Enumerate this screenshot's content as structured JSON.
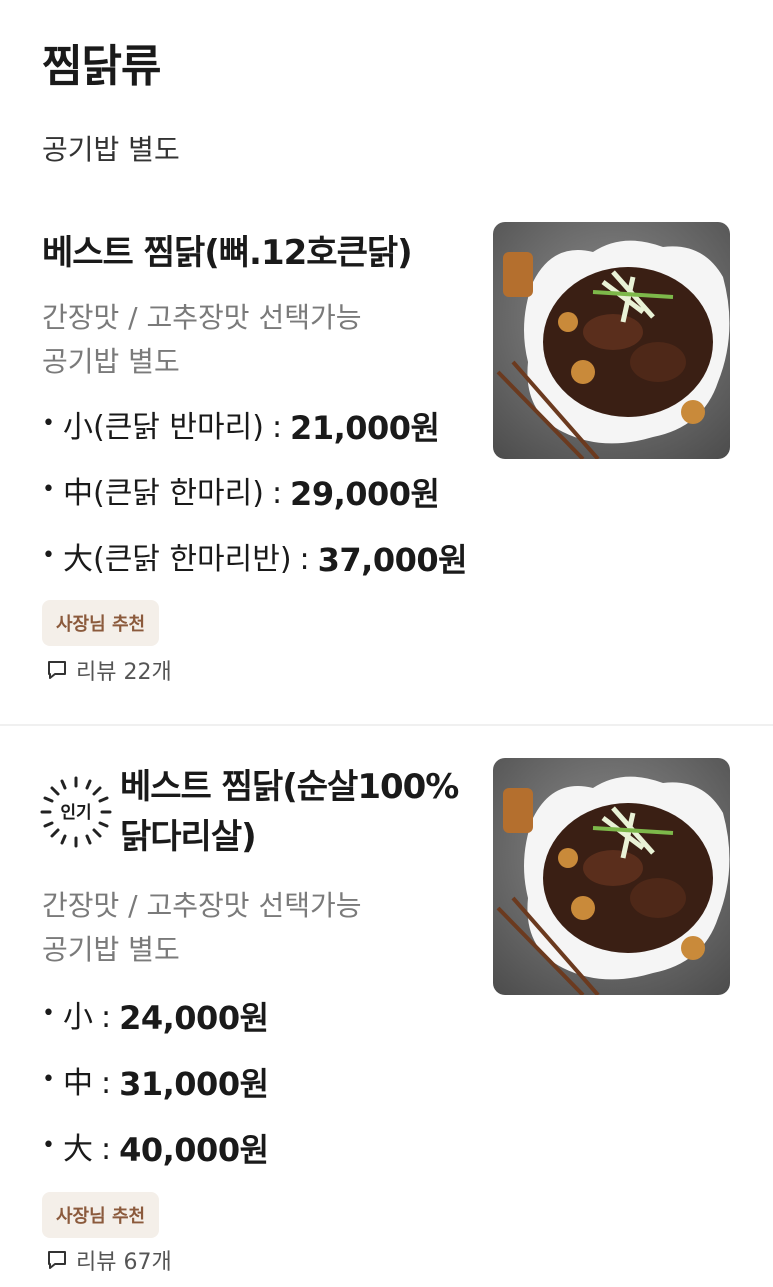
{
  "section": {
    "title": "찜닭류",
    "subtitle": "공기밥 별도"
  },
  "items": [
    {
      "name": "베스트 찜닭(뼈.12호큰닭)",
      "desc1": "간장맛 / 고추장맛 선택가능",
      "desc2": "공기밥 별도",
      "prices": [
        {
          "label": "小(큰닭 반마리)",
          "value": "21,000원"
        },
        {
          "label": "中(큰닭 한마리)",
          "value": "29,000원"
        },
        {
          "label": "大(큰닭 한마리반)",
          "value": "37,000원"
        }
      ],
      "tag": "사장님 추천",
      "review": "리뷰 22개"
    },
    {
      "badge": "인기",
      "name_line1": "베스트 찜닭(순살100%",
      "name_line2": "닭다리살)",
      "desc1": "간장맛 / 고추장맛 선택가능",
      "desc2": "공기밥 별도",
      "prices": [
        {
          "label": "小",
          "value": "24,000원"
        },
        {
          "label": "中",
          "value": "31,000원"
        },
        {
          "label": "大",
          "value": "40,000원"
        }
      ],
      "tag": "사장님 추천",
      "review": "리뷰 67개"
    }
  ],
  "icons": {
    "review": "speech-bubble-icon",
    "popular": "popular-burst-icon"
  },
  "colors": {
    "tag_bg": "#f4efe9",
    "tag_text": "#8b5a3c",
    "desc": "#7a7a7a"
  }
}
